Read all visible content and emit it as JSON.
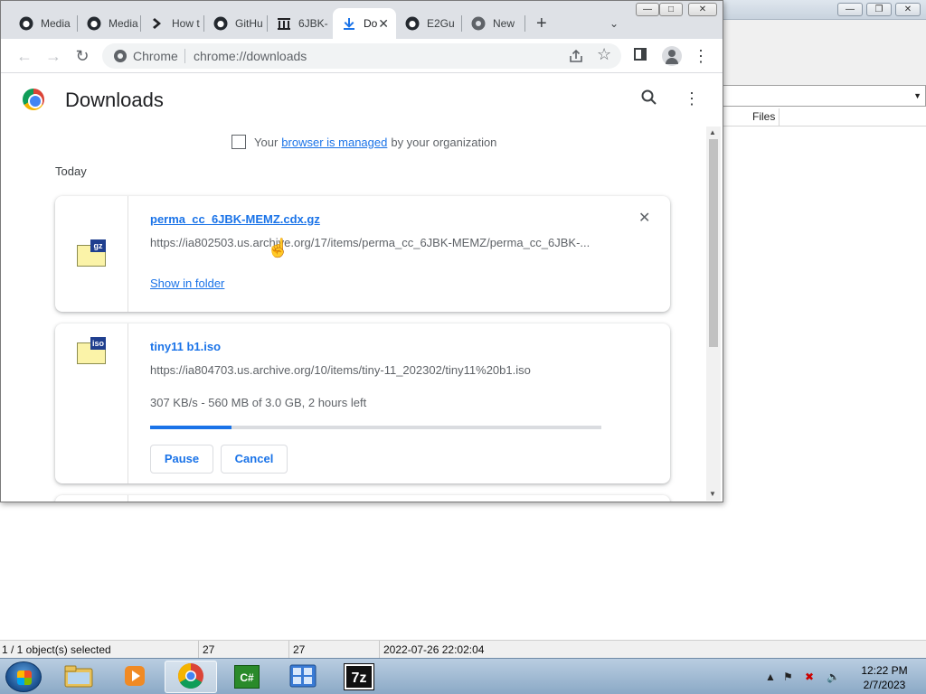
{
  "background_app": {
    "column_files": "Files",
    "status": {
      "selection": "1 / 1 object(s) selected",
      "size1": "27",
      "size2": "27",
      "modified": "2022-07-26 22:02:04"
    }
  },
  "browser": {
    "tabs": [
      {
        "label": "Media",
        "icon": "github-icon"
      },
      {
        "label": "Media",
        "icon": "github-icon"
      },
      {
        "label": "How t",
        "icon": "chevron-right-icon"
      },
      {
        "label": "GitHu",
        "icon": "github-icon"
      },
      {
        "label": "6JBK-",
        "icon": "archive-icon"
      },
      {
        "label": "Do",
        "icon": "download-icon",
        "active": true
      },
      {
        "label": "E2Gu",
        "icon": "github-icon"
      },
      {
        "label": "New",
        "icon": "chrome-icon"
      }
    ],
    "new_tab_label": "+",
    "omnibox": {
      "scheme_label": "Chrome",
      "url": "chrome://downloads"
    }
  },
  "downloads": {
    "title": "Downloads",
    "managed": {
      "prefix": "Your",
      "link": "browser is managed",
      "suffix": "by your organization"
    },
    "section": "Today",
    "items": [
      {
        "filename": "perma_cc_6JBK-MEMZ.cdx.gz",
        "url": "https://ia802503.us.archive.org/17/items/perma_cc_6JBK-MEMZ/perma_cc_6JBK-...",
        "action_link": "Show in folder",
        "type_tag": "gz"
      },
      {
        "filename": "tiny11 b1.iso",
        "url": "https://ia804703.us.archive.org/10/items/tiny-11_202302/tiny11%20b1.iso",
        "status": "307 KB/s - 560 MB of 3.0 GB, 2 hours left",
        "progress_fraction": 0.18,
        "pause_label": "Pause",
        "cancel_label": "Cancel",
        "type_tag": "iso"
      }
    ]
  },
  "taskbar": {
    "items": [
      {
        "name": "explorer",
        "icon": "folder-icon"
      },
      {
        "name": "media-player",
        "icon": "media-player-icon"
      },
      {
        "name": "chrome",
        "icon": "chrome-icon",
        "active": true
      },
      {
        "name": "csharp",
        "label": "C#",
        "icon": "csharp-icon"
      },
      {
        "name": "control-panel",
        "icon": "control-panel-icon"
      },
      {
        "name": "7zip",
        "label": "7z",
        "icon": "7zip-icon"
      }
    ],
    "clock": {
      "time": "12:22 PM",
      "date": "2/7/2023"
    }
  }
}
